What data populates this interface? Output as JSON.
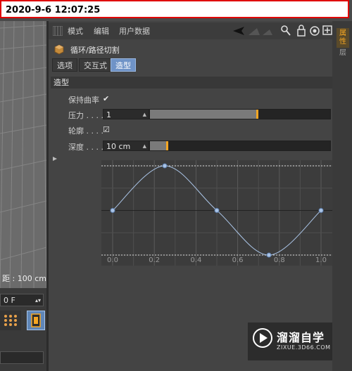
{
  "banner": {
    "timestamp": "2020-9-6  12:07:25"
  },
  "viewport": {
    "distance_label": "距 : 100 cm"
  },
  "timeline": {
    "frame_value": "0 F"
  },
  "toolbar": {
    "menu": [
      "模式",
      "编辑",
      "用户数据"
    ]
  },
  "object": {
    "title": "循环/路径切割"
  },
  "tabs": [
    {
      "label": "选项",
      "active": false
    },
    {
      "label": "交互式",
      "active": false
    },
    {
      "label": "造型",
      "active": true
    }
  ],
  "section": {
    "title": "造型"
  },
  "params": {
    "keep_curve": {
      "label": "保持曲率",
      "checked": true,
      "mark": "✔"
    },
    "pressure": {
      "label": "压力 . . . .",
      "value": "1",
      "slider_fill": 0.6
    },
    "profile": {
      "label": "轮廓 . . . .",
      "checked": true,
      "mark": "☑"
    },
    "depth": {
      "label": "深度 . . . .",
      "value": "10 cm",
      "slider_fill": 0.1
    }
  },
  "spline_graph": {
    "x_ticks": [
      "0.0",
      "0.2",
      "0.4",
      "0.6",
      "0.8",
      "1.0"
    ],
    "points": [
      [
        0.0,
        0.5
      ],
      [
        0.25,
        1.0
      ],
      [
        0.5,
        0.5
      ],
      [
        0.75,
        0.0
      ],
      [
        1.0,
        0.5
      ]
    ]
  },
  "right_tabs": [
    "属性",
    "层"
  ],
  "watermark": {
    "name": "溜溜自学",
    "url": "ZIXUE.3D66.COM"
  },
  "colors": {
    "accent_orange": "#f5a623",
    "active_tab": "#6f93c7",
    "frame_red": "#e00000"
  }
}
